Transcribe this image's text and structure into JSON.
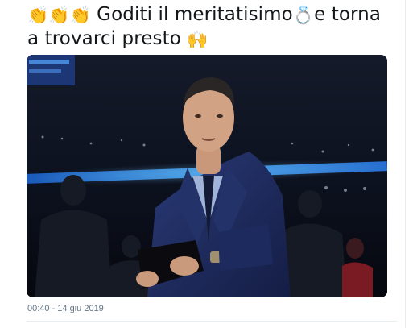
{
  "tweet": {
    "clap_emojis": "👏👏👏",
    "text_part1": " Goditi il meritatisimo",
    "ring_emoji": "💍",
    "text_part2": "e torna a trovarci presto ",
    "raised_hands_emoji": "🙌",
    "timestamp": "00:40 - 14 giu 2019"
  },
  "icons": {
    "clap": "clapping-hands-emoji",
    "ring": "ring-emoji",
    "hands": "raising-hands-emoji"
  },
  "colors": {
    "text": "#14171a",
    "meta": "#657786",
    "arena_light": "#4aa3ff",
    "suit": "#1d2b5c"
  }
}
